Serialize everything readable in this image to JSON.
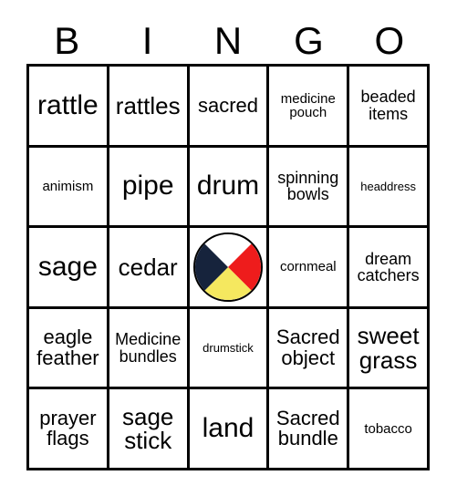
{
  "card": {
    "title": "BINGO",
    "background_color": "#ffffff",
    "border_color": "#000000"
  },
  "header": {
    "letters": [
      "B",
      "I",
      "N",
      "G",
      "O"
    ]
  },
  "grid": {
    "rows": 5,
    "columns": 5,
    "cells": [
      [
        {
          "text": "rattle",
          "size": "xl"
        },
        {
          "text": "rattles",
          "size": "lg"
        },
        {
          "text": "sacred",
          "size": "md"
        },
        {
          "text": "medicine\npouch",
          "size": "xs"
        },
        {
          "text": "beaded\nitems",
          "size": "sm"
        }
      ],
      [
        {
          "text": "animism",
          "size": "xs"
        },
        {
          "text": "pipe",
          "size": "xl"
        },
        {
          "text": "drum",
          "size": "xl"
        },
        {
          "text": "spinning\nbowls",
          "size": "sm"
        },
        {
          "text": "headdress",
          "size": "xxs"
        }
      ],
      [
        {
          "text": "sage",
          "size": "xl"
        },
        {
          "text": "cedar",
          "size": "lg"
        },
        {
          "text": "",
          "size": "md",
          "icon": "medicine-wheel-icon",
          "free_space": true
        },
        {
          "text": "cornmeal",
          "size": "xs"
        },
        {
          "text": "dream\ncatchers",
          "size": "sm"
        }
      ],
      [
        {
          "text": "eagle\nfeather",
          "size": "md"
        },
        {
          "text": "Medicine\nbundles",
          "size": "sm"
        },
        {
          "text": "drumstick",
          "size": "xxs"
        },
        {
          "text": "Sacred\nobject",
          "size": "md"
        },
        {
          "text": "sweet\ngrass",
          "size": "lg"
        }
      ],
      [
        {
          "text": "prayer\nflags",
          "size": "md"
        },
        {
          "text": "sage\nstick",
          "size": "lg"
        },
        {
          "text": "land",
          "size": "xl"
        },
        {
          "text": "Sacred\nbundle",
          "size": "md"
        },
        {
          "text": "tobacco",
          "size": "xs"
        }
      ]
    ]
  },
  "medicine_wheel": {
    "name": "medicine-wheel-icon",
    "quadrants": [
      {
        "position": "top",
        "color": "#ffffff"
      },
      {
        "position": "right",
        "color": "#ee1c1c"
      },
      {
        "position": "bottom",
        "color": "#f5e85f"
      },
      {
        "position": "left",
        "color": "#16233c"
      }
    ],
    "outline_color": "#000000"
  }
}
